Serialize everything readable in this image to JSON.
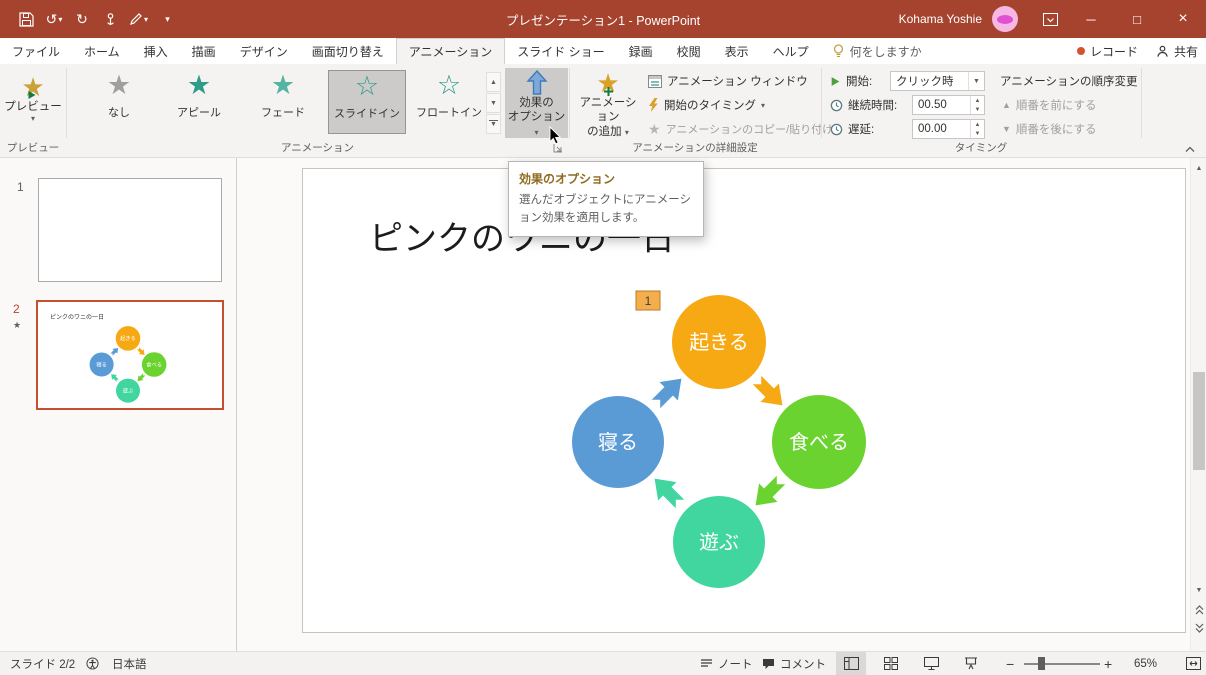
{
  "colors": {
    "titlebar_accent": "#A5432E",
    "selected_slide_border": "#C4502E"
  },
  "titlebar": {
    "title": "プレゼンテーション1 - PowerPoint",
    "user_name": "Kohama Yoshie"
  },
  "tabs": {
    "file": "ファイル",
    "home": "ホーム",
    "insert": "挿入",
    "draw": "描画",
    "design": "デザイン",
    "transitions": "画面切り替え",
    "animations": "アニメーション",
    "slideshow": "スライド ショー",
    "recording": "録画",
    "review": "校閲",
    "view": "表示",
    "help": "ヘルプ",
    "tellme": "何をしますか",
    "record_button": "レコード",
    "share_button": "共有"
  },
  "ribbon": {
    "preview_button": "プレビュー",
    "group_preview": "プレビュー",
    "gallery": {
      "none": "なし",
      "appeal": "アピール",
      "fade": "フェード",
      "slidein": "スライドイン",
      "floatin": "フロートイン"
    },
    "group_animation": "アニメーション",
    "effect_options_line1": "効果の",
    "effect_options_line2": "オプション",
    "add_animation_line1": "アニメーション",
    "add_animation_line2": "の追加",
    "animation_pane": "アニメーション ウィンドウ",
    "trigger": "開始のタイミング",
    "animation_painter": "アニメーションのコピー/貼り付け",
    "group_advanced": "アニメーションの詳細設定",
    "start_label": "開始:",
    "start_value": "クリック時",
    "duration_label": "継続時間:",
    "duration_value": "00.50",
    "delay_label": "遅延:",
    "delay_value": "00.00",
    "reorder_label": "アニメーションの順序変更",
    "move_earlier": "順番を前にする",
    "move_later": "順番を後にする",
    "group_timing": "タイミング"
  },
  "tooltip": {
    "title": "効果のオプション",
    "body": "選んだオブジェクトにアニメーション効果を適用します。"
  },
  "slides_panel": {
    "slide1_number": "1",
    "slide2_number": "2",
    "thumb_title": "ピンクのワニの一日"
  },
  "slide": {
    "title": "ピンクのワニの一日",
    "badge": "1",
    "diagram": {
      "top": {
        "label": "起きる",
        "color": "#F7A913"
      },
      "right": {
        "label": "食べる",
        "color": "#6BD32F"
      },
      "bottom": {
        "label": "遊ぶ",
        "color": "#41D6A0"
      },
      "left": {
        "label": "寝る",
        "color": "#5B9BD5"
      }
    }
  },
  "statusbar": {
    "slide_counter": "スライド 2/2",
    "language": "日本語",
    "notes": "ノート",
    "comments": "コメント",
    "zoom_level": "65%"
  }
}
